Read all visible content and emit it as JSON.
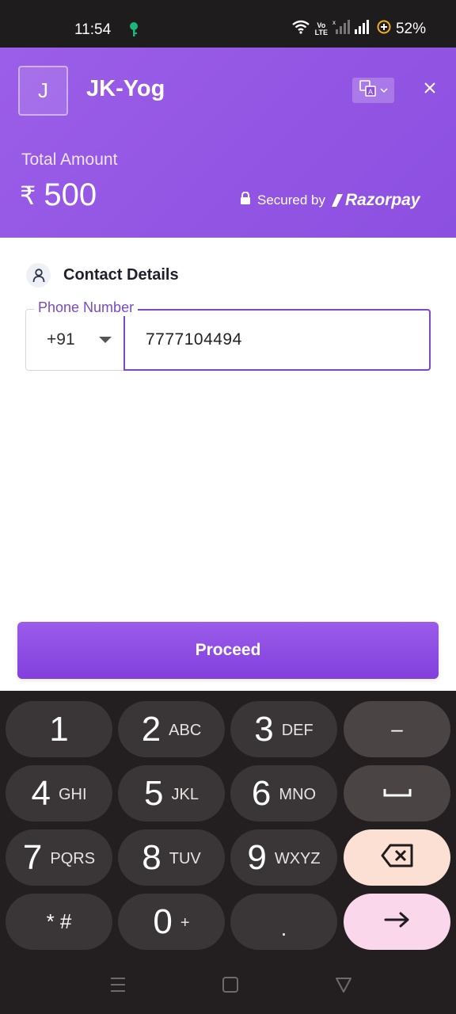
{
  "status_bar": {
    "time": "11:54",
    "battery_percent": "52%",
    "network_badge": "Vo\nLTE"
  },
  "header": {
    "avatar_initial": "J",
    "merchant_name": "JK-Yog",
    "total_label": "Total Amount",
    "currency_symbol": "₹",
    "amount": "500",
    "secured_by": "Secured by",
    "brand": "Razorpay"
  },
  "contact": {
    "title": "Contact Details",
    "phone_label": "Phone Number",
    "country_code": "+91",
    "phone_value": "7777104494"
  },
  "proceed_label": "Proceed",
  "keyboard": {
    "keys": [
      {
        "digit": "1",
        "letters": ""
      },
      {
        "digit": "2",
        "letters": "ABC"
      },
      {
        "digit": "3",
        "letters": "DEF"
      },
      {
        "digit": "4",
        "letters": "GHI"
      },
      {
        "digit": "5",
        "letters": "JKL"
      },
      {
        "digit": "6",
        "letters": "MNO"
      },
      {
        "digit": "7",
        "letters": "PQRS"
      },
      {
        "digit": "8",
        "letters": "TUV"
      },
      {
        "digit": "9",
        "letters": "WXYZ"
      },
      {
        "digit": "0",
        "letters": "+"
      }
    ],
    "star_hash": "* #",
    "dot": ".",
    "minus": "–"
  },
  "colors": {
    "header_purple": "#9258e6",
    "accent": "#7a48c9",
    "keyboard_bg": "#231f20",
    "backspace_key": "#fde0d4",
    "enter_key": "#fbd7ec"
  }
}
